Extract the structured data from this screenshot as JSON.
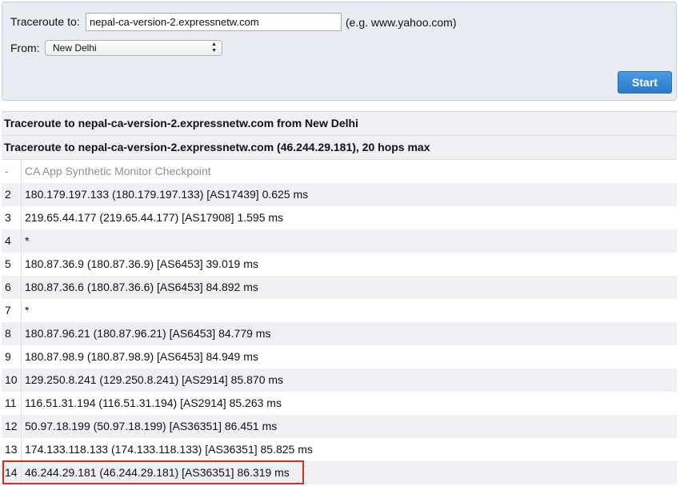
{
  "form": {
    "traceroute_label": "Traceroute to:",
    "target_value": "nepal-ca-version-2.expressnetw.com",
    "example_hint": "(e.g. www.yahoo.com)",
    "from_label": "From:",
    "from_selected": "New Delhi",
    "start_label": "Start"
  },
  "results": {
    "header_1": "Traceroute to nepal-ca-version-2.expressnetw.com from New Delhi",
    "header_2": "Traceroute to nepal-ca-version-2.expressnetw.com (46.244.29.181), 20 hops max",
    "hops": [
      {
        "num": "-",
        "text": "CA App Synthetic Monitor Checkpoint"
      },
      {
        "num": "2",
        "text": "180.179.197.133 (180.179.197.133) [AS17439] 0.625 ms"
      },
      {
        "num": "3",
        "text": "219.65.44.177 (219.65.44.177) [AS17908] 1.595 ms"
      },
      {
        "num": "4",
        "text": "*"
      },
      {
        "num": "5",
        "text": "180.87.36.9 (180.87.36.9) [AS6453] 39.019 ms"
      },
      {
        "num": "6",
        "text": "180.87.36.6 (180.87.36.6) [AS6453] 84.892 ms"
      },
      {
        "num": "7",
        "text": "*"
      },
      {
        "num": "8",
        "text": "180.87.96.21 (180.87.96.21) [AS6453] 84.779 ms"
      },
      {
        "num": "9",
        "text": "180.87.98.9 (180.87.98.9) [AS6453] 84.949 ms"
      },
      {
        "num": "10",
        "text": "129.250.8.241 (129.250.8.241) [AS2914] 85.870 ms"
      },
      {
        "num": "11",
        "text": "116.51.31.194 (116.51.31.194) [AS2914] 85.263 ms"
      },
      {
        "num": "12",
        "text": "50.97.18.199 (50.97.18.199) [AS36351] 86.451 ms"
      },
      {
        "num": "13",
        "text": "174.133.118.133 (174.133.118.133) [AS36351] 85.825 ms"
      },
      {
        "num": "14",
        "text": "46.244.29.181 (46.244.29.181) [AS36351] 86.319 ms"
      }
    ]
  },
  "colors": {
    "panel_bg": "#e9edf3",
    "row_alt_bg": "#eef0f3",
    "button_blue": "#2b79cc",
    "highlight_red": "#e02a1e"
  },
  "icons": {
    "select_arrows": "up-down-chevron-icon"
  }
}
